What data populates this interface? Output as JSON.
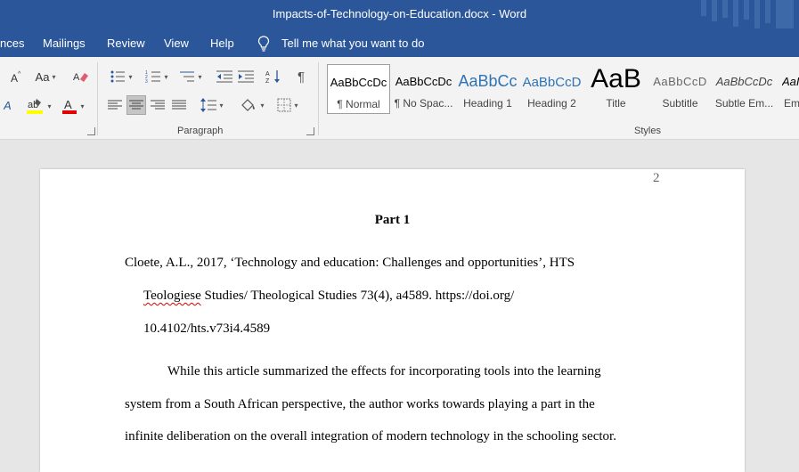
{
  "window": {
    "title": "Impacts-of-Technology-on-Education.docx  -  Word"
  },
  "menu": {
    "items": [
      "nces",
      "Mailings",
      "Review",
      "View",
      "Help"
    ],
    "tell_me": "Tell me what you want to do"
  },
  "ribbon": {
    "font_case_label": "Aa",
    "groups": {
      "paragraph": "Paragraph",
      "styles": "Styles"
    },
    "styles": [
      {
        "preview": "AaBbCcDc",
        "name": "¶ Normal"
      },
      {
        "preview": "AaBbCcDc",
        "name": "¶ No Spac..."
      },
      {
        "preview": "AaBbCc",
        "name": "Heading 1"
      },
      {
        "preview": "AaBbCcD",
        "name": "Heading 2"
      },
      {
        "preview": "AaB",
        "name": "Title"
      },
      {
        "preview": "AaBbCcD",
        "name": "Subtitle"
      },
      {
        "preview": "AaBbCcDc",
        "name": "Subtle Em..."
      },
      {
        "preview": "AaI",
        "name": "Em"
      }
    ]
  },
  "document": {
    "page_number": "2",
    "heading": "Part 1",
    "reference": {
      "line1": "Cloete, A.L., 2017, ‘Technology and education: Challenges and opportunities’, HTS",
      "line2_misspelled": "Teologiese",
      "line2_rest": " Studies/ Theological Studies 73(4), a4589. https://doi.org/",
      "line3": "10.4102/hts.v73i4.4589"
    },
    "body": [
      "While this article summarized the effects for incorporating tools into the learning",
      "system from a South African perspective, the author works towards playing a part in the",
      "infinite deliberation on the overall integration of modern technology in the schooling sector."
    ]
  },
  "colors": {
    "titlebar": "#2b579a",
    "ribbon": "#f3f3f3",
    "canvas": "#e6e6e6",
    "heading1_preview": "#2e74b5"
  }
}
